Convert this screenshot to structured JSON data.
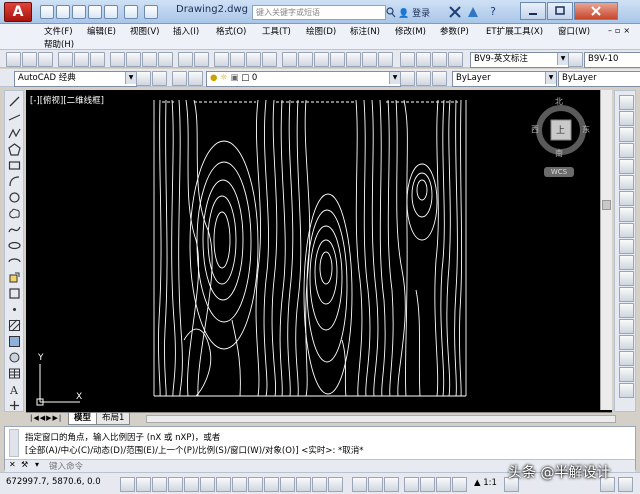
{
  "app": {
    "logo_letter": "A",
    "document_title": "Drawing2.dwg",
    "search_placeholder": "键入关键字或短语",
    "login_label": "登录"
  },
  "menu": [
    "文件(F)",
    "编辑(E)",
    "视图(V)",
    "插入(I)",
    "格式(O)",
    "工具(T)",
    "绘图(D)",
    "标注(N)",
    "修改(M)",
    "参数(P)",
    "ET扩展工具(X)",
    "窗口(W)",
    "帮助(H)"
  ],
  "toolbar": {
    "dim_style": "BV9-英文标注",
    "text_style": "B9V-10",
    "workspace": "AutoCAD 经典",
    "layer": "0",
    "color": "ByLayer",
    "linetype": "ByLayer"
  },
  "viewport": {
    "label": "[-][俯视][二维线框]",
    "ucs_y": "Y",
    "ucs_x": "X"
  },
  "viewcube": {
    "north": "北",
    "south": "南",
    "east": "东",
    "west": "西",
    "top": "上",
    "wcs": "WCS"
  },
  "layout_tabs": [
    "模型",
    "布局1"
  ],
  "command": {
    "history_1": "指定窗口的角点，输入比例因子 (nX 或 nXP)，或者",
    "history_2": "[全部(A)/中心(C)/动态(D)/范围(E)/上一个(P)/比例(S)/窗口(W)/对象(O)] <实时>: *取消*",
    "input_placeholder": "键入命令"
  },
  "status": {
    "coordinates": "672997.7, 5870.6, 0.0",
    "scale": "1:1"
  },
  "watermark": "头条 @半解设计"
}
